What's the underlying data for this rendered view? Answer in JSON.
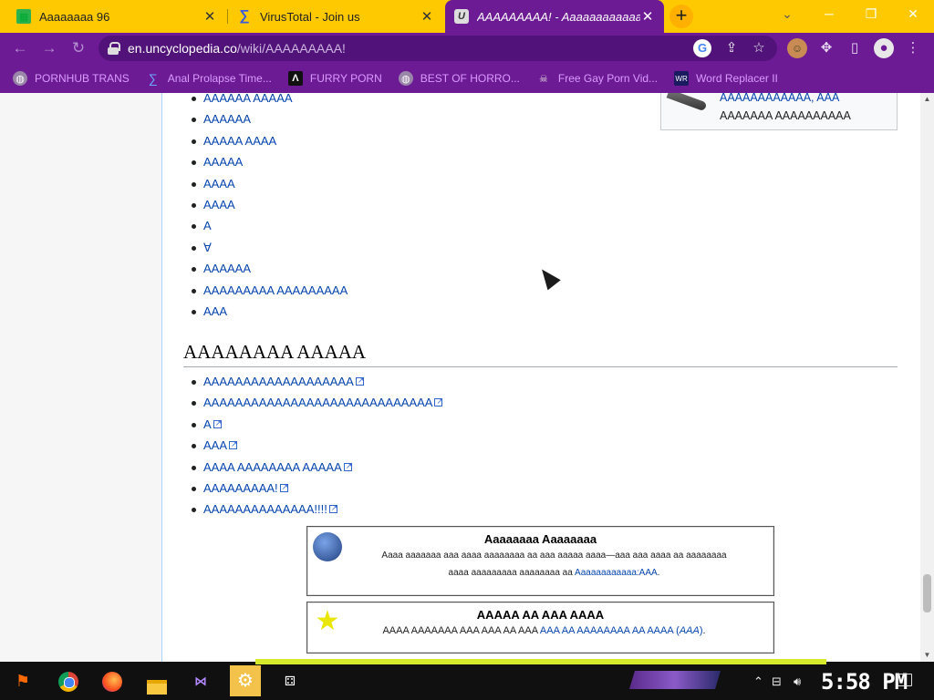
{
  "tabs": [
    {
      "title": "Aaaaaaaa 96",
      "icon": "sheet-favicon"
    },
    {
      "title": "VirusTotal - Join us",
      "icon": "virustotal-favicon"
    },
    {
      "title": "AAAAAAAAA! - Aaaaaaaaaaaa",
      "icon": "uncyclopedia-favicon",
      "active": true
    }
  ],
  "toolbar": {
    "url_host": "en.uncyclopedia.co",
    "url_path": "/wiki/AAAAAAAAA!"
  },
  "bookmarks": [
    {
      "label": "PORNHUB TRANS",
      "icon": "globe-icon"
    },
    {
      "label": "Anal Prolapse Time...",
      "icon": "sigma-icon"
    },
    {
      "label": "FURRY PORN",
      "icon": "lambda-icon"
    },
    {
      "label": "BEST OF HORRO...",
      "icon": "globe-icon"
    },
    {
      "label": "Free Gay Porn Vid...",
      "icon": "skull-icon"
    },
    {
      "label": "Word Replacer II",
      "icon": "wr-icon"
    }
  ],
  "infobox": {
    "line1": "AAAAAAAAAAAA, AAA",
    "line2": "AAAAAAA AAAAAAAAAA"
  },
  "list1": [
    "AAAAAA AAAAA",
    "AAAAAA",
    "AAAAA AAAA",
    "AAAAA",
    "AAAA",
    "AAAA",
    "A",
    "∀",
    "AAAAAA",
    "AAAAAAAAA AAAAAAAAA",
    "AAA"
  ],
  "section_heading": "AAAAAAAA AAAAA",
  "list2": [
    "AAAAAAAAAAAAAAAAAAA",
    "AAAAAAAAAAAAAAAAAAAAAAAAAAAAA",
    "A",
    "AAA",
    "AAAA AAAAAAAA AAAAA",
    "AAAAAAAAA!",
    "AAAAAAAAAAAAAA!!!!"
  ],
  "box1": {
    "title": "Aaaaaaaa Aaaaaaaa",
    "line1": "Aaaa aaaaaaa aaa aaaa aaaaaaaa aa aaa aaaaa aaaa—aaa aaa aaaa aa aaaaaaaa",
    "line2_text": "aaaa aaaaaaaaa aaaaaaaa aa ",
    "line2_link": "Aaaaaaaaaaaa:AAA",
    "line2_end": "."
  },
  "box2": {
    "title": "AAAAA AA AAA AAAA",
    "text": "AAAA AAAAAAA AAA AAA AA AAA ",
    "link": "AAA AA AAAAAAAA AA AAAA",
    "paren_link": "AAA",
    "end": "."
  },
  "taskbar": {
    "clock": "5:58 PM"
  }
}
